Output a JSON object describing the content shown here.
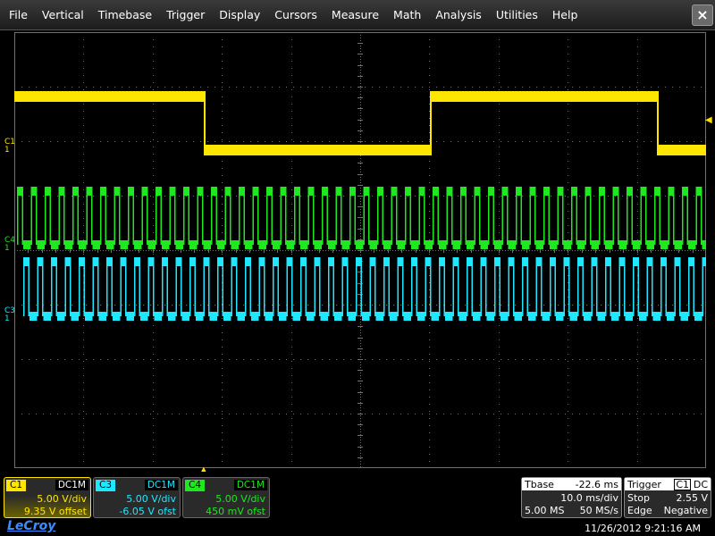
{
  "menu": {
    "items": [
      "File",
      "Vertical",
      "Timebase",
      "Trigger",
      "Display",
      "Cursors",
      "Measure",
      "Math",
      "Analysis",
      "Utilities",
      "Help"
    ],
    "close_label": "×"
  },
  "colors": {
    "c1": "#ffe600",
    "c3": "#1ee8ff",
    "c4": "#1ee81e",
    "grid": "#707070"
  },
  "traces": {
    "c1_label": "C1",
    "c4_label": "C4",
    "c3_label": "C3"
  },
  "channels": {
    "c1": {
      "tag": "C1",
      "coupling": "DC1M",
      "scale": "5.00 V/div",
      "offset": "9.35 V offset"
    },
    "c3": {
      "tag": "C3",
      "coupling": "DC1M",
      "scale": "5.00 V/div",
      "offset": "-6.05 V ofst"
    },
    "c4": {
      "tag": "C4",
      "coupling": "DC1M",
      "scale": "5.00 V/div",
      "offset": "450 mV ofst"
    }
  },
  "timebase": {
    "title": "Tbase",
    "delay": "-22.6 ms",
    "scale": "10.0 ms/div",
    "samples": "5.00 MS",
    "rate": "50 MS/s"
  },
  "trigger": {
    "title": "Trigger",
    "source": "C1",
    "coupling": "DC",
    "mode": "Stop",
    "level": "2.55 V",
    "type": "Edge",
    "slope": "Negative"
  },
  "footer": {
    "brand": "LeCroy",
    "timestamp": "11/26/2012 9:21:16 AM"
  }
}
